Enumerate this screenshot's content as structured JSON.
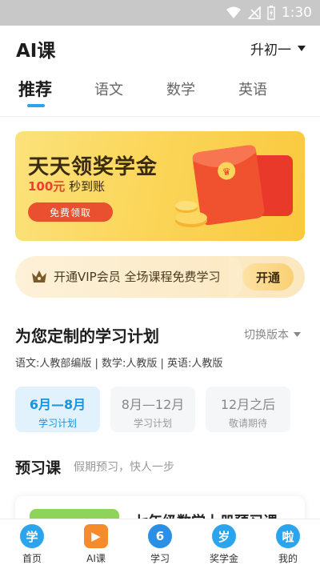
{
  "status_bar": {
    "time": "1:30",
    "icons": [
      "wifi-icon",
      "signal-icon",
      "battery-icon"
    ]
  },
  "header": {
    "title": "AI课",
    "grade": "升初一"
  },
  "tabs": [
    {
      "label": "推荐",
      "active": true
    },
    {
      "label": "语文",
      "active": false
    },
    {
      "label": "数学",
      "active": false
    },
    {
      "label": "英语",
      "active": false
    }
  ],
  "banner": {
    "title": "天天领奖学金",
    "amount": "100元",
    "sub_suffix": "秒到账",
    "button": "免费领取"
  },
  "vip": {
    "text": "开通VIP会员 全场课程免费学习",
    "button": "开通"
  },
  "plan": {
    "title": "为您定制的学习计划",
    "switch_label": "切换版本",
    "versions": "语文:人教部编版 | 数学:人教版 | 英语:人教版",
    "cards": [
      {
        "period": "6月—8月",
        "desc": "学习计划",
        "active": true
      },
      {
        "period": "8月—12月",
        "desc": "学习计划",
        "active": false
      },
      {
        "period": "12月之后",
        "desc": "敬请期待",
        "active": false
      }
    ]
  },
  "preview": {
    "title": "预习课",
    "subtitle": "假期预习，快人一步",
    "course_name": "七年级数学上册预习课"
  },
  "bottom_nav": [
    {
      "label": "首页",
      "icon_text": "学",
      "icon": "home-icon",
      "color": "#2aa4ec"
    },
    {
      "label": "AI课",
      "icon_text": "▶",
      "icon": "ai-lesson-icon",
      "color": "#f58b2a"
    },
    {
      "label": "学习",
      "icon_text": "6",
      "icon": "study-icon",
      "color": "#2a8fe6"
    },
    {
      "label": "奖学金",
      "icon_text": "岁",
      "icon": "scholarship-icon",
      "color": "#2aa4ec"
    },
    {
      "label": "我的",
      "icon_text": "啦",
      "icon": "profile-icon",
      "color": "#2aa4ec"
    }
  ],
  "colors": {
    "accent": "#2aa4ec",
    "banner_button": "#e8502f",
    "active_plan": "#1a93dd"
  }
}
